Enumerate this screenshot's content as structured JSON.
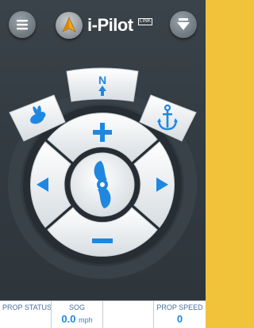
{
  "header": {
    "menu_icon": "hamburger-menu-icon",
    "logo_icon": "compass-arrow-icon",
    "brand": "i-Pilot",
    "brand_badge": "LINK",
    "download_icon": "down-arrow-icon"
  },
  "controls": {
    "north_label": "N",
    "speed_mode_icon": "rabbit-icon",
    "anchor_icon": "anchor-icon",
    "increase_icon": "plus-icon",
    "decrease_icon": "minus-icon",
    "left_icon": "left-arrow-icon",
    "right_icon": "right-arrow-icon",
    "center_icon": "propeller-icon"
  },
  "status": {
    "prop_status_label": "PROP STATUS",
    "prop_status_value": "",
    "sog_label": "SOG",
    "sog_value": "0.0",
    "sog_unit": "mph",
    "prop_speed_label": "PROP SPEED",
    "prop_speed_value": "0"
  },
  "colors": {
    "accent_blue": "#1f87e0",
    "background": "#333b42",
    "frame": "#f0c33a"
  }
}
